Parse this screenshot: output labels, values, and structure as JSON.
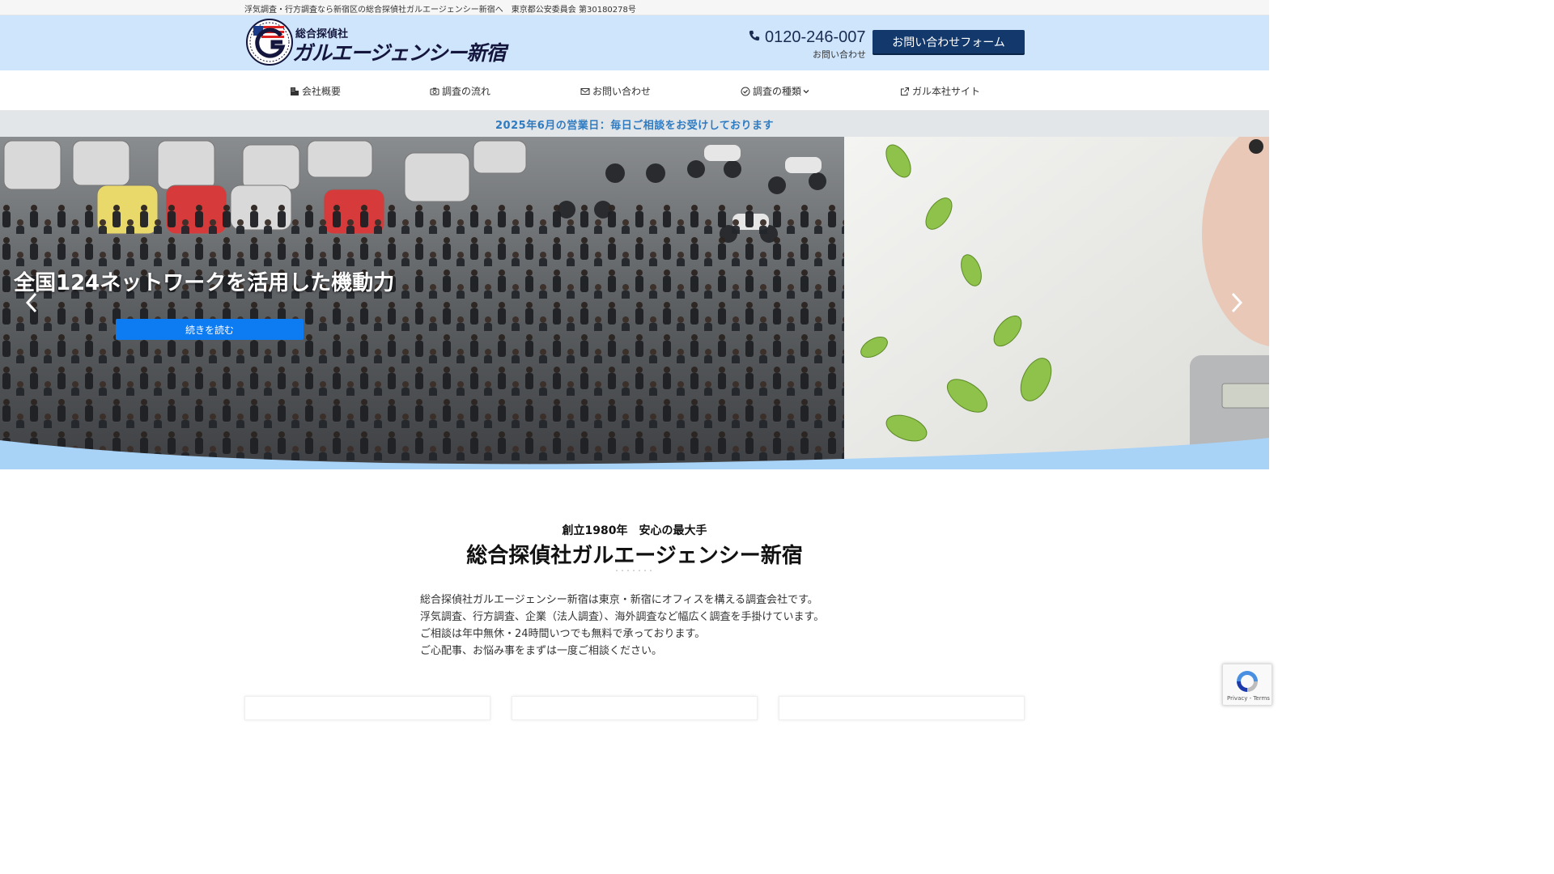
{
  "topbar": {
    "text": "浮気調査・行方調査なら新宿区の総合探偵社ガルエージェンシー新宿へ　東京都公安委員会 第30180278号"
  },
  "header": {
    "logo_small": "総合探偵社",
    "logo_big": "ガルエージェンシー新宿",
    "phone_number": "0120-246-007",
    "phone_sub": "お問い合わせ",
    "contact_button": "お問い合わせフォーム"
  },
  "nav": {
    "items": [
      {
        "label": "会社概要",
        "icon": "building-icon"
      },
      {
        "label": "調査の流れ",
        "icon": "camera-icon"
      },
      {
        "label": "お問い合わせ",
        "icon": "envelope-icon"
      },
      {
        "label": "調査の種類",
        "icon": "check-circle-icon"
      },
      {
        "label": "ガル本社サイト",
        "icon": "external-link-icon"
      }
    ]
  },
  "notice": {
    "text": "2025年6月の営業日：毎日ご相談をお受けしております"
  },
  "hero": {
    "title": "全国124ネットワークを活用した機動力",
    "button": "続きを読む"
  },
  "intro": {
    "subtitle": "創立1980年　安心の最大手",
    "title": "総合探偵社ガルエージェンシー新宿",
    "lines": [
      "総合探偵社ガルエージェンシー新宿は東京・新宿にオフィスを構える調査会社です。",
      "浮気調査、行方調査、企業（法人調査）、海外調査など幅広く調査を手掛けています。",
      "ご相談は年中無休・24時間いつでも無料で承っております。",
      "ご心配事、お悩み事をまずは一度ご相談ください。"
    ]
  },
  "recaptcha": {
    "text": "Privacy - Terms"
  },
  "colors": {
    "header_bg": "#cfe5fb",
    "contact_btn": "#12386c",
    "notice_text": "#2f7bc2",
    "hero_btn": "#0d7bf2",
    "wave": "#a9d2f7"
  }
}
